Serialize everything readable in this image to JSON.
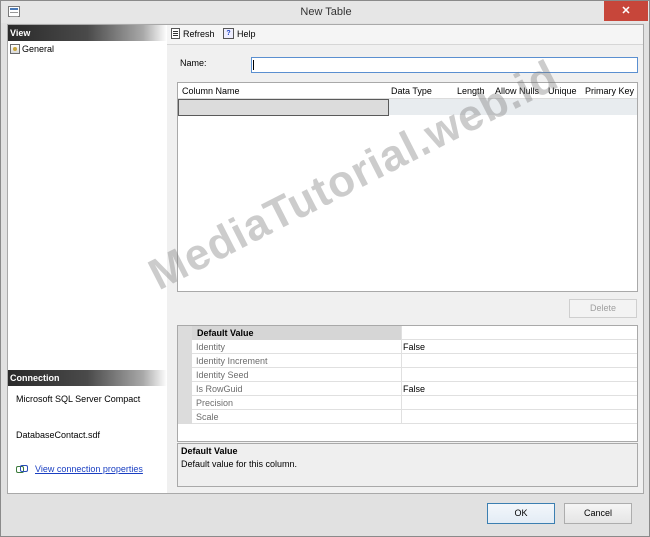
{
  "window": {
    "title": "New Table",
    "close_label": "✕"
  },
  "left_pane": {
    "view_header": "View",
    "items": [
      {
        "label": "General"
      }
    ],
    "connection_header": "Connection",
    "server": "Microsoft SQL Server Compact",
    "database": "DatabaseContact.sdf",
    "view_connection_link": "View connection properties"
  },
  "toolbar": {
    "refresh_label": "Refresh",
    "help_label": "Help"
  },
  "form": {
    "name_label": "Name:",
    "name_value": ""
  },
  "columns_grid": {
    "headers": [
      "Column Name",
      "Data Type",
      "Length",
      "Allow Nulls",
      "Unique",
      "Primary Key"
    ]
  },
  "delete_label": "Delete",
  "properties": [
    {
      "name": "Default Value",
      "value": ""
    },
    {
      "name": "Identity",
      "value": "False"
    },
    {
      "name": "Identity Increment",
      "value": ""
    },
    {
      "name": "Identity Seed",
      "value": ""
    },
    {
      "name": "Is RowGuid",
      "value": "False"
    },
    {
      "name": "Precision",
      "value": ""
    },
    {
      "name": "Scale",
      "value": ""
    }
  ],
  "description": {
    "title": "Default Value",
    "text": "Default value for this column."
  },
  "buttons": {
    "ok": "OK",
    "cancel": "Cancel"
  },
  "watermark": "MediaTutorial.web.id"
}
